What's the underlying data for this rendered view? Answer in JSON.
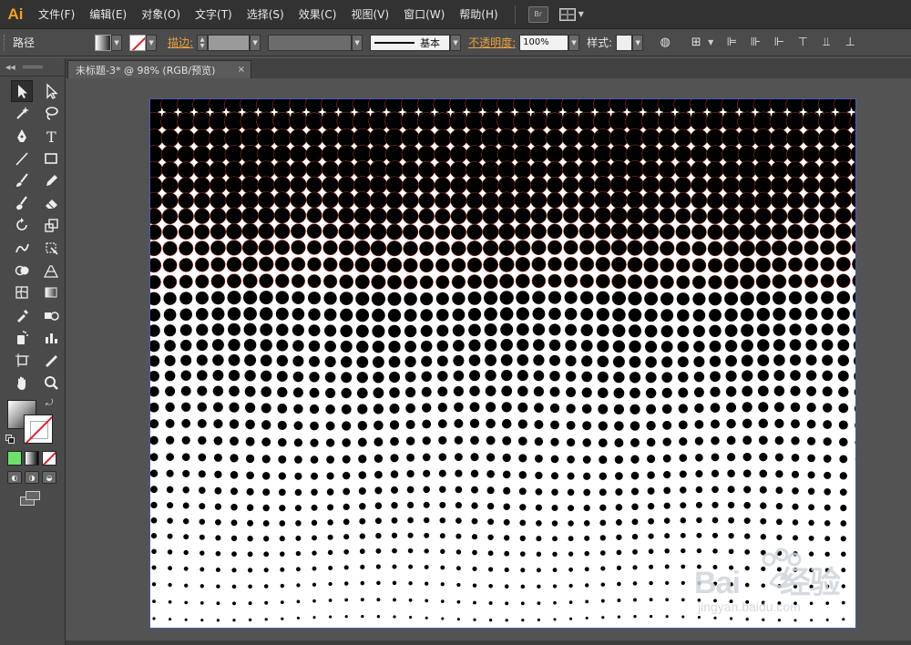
{
  "app": {
    "logo": "Ai"
  },
  "menu": {
    "items": [
      "文件(F)",
      "编辑(E)",
      "对象(O)",
      "文字(T)",
      "选择(S)",
      "效果(C)",
      "视图(V)",
      "窗口(W)",
      "帮助(H)"
    ],
    "bridge": "Br"
  },
  "control": {
    "selection_type": "路径",
    "stroke_label": "描边:",
    "stroke_style": "基本",
    "opacity_label": "不透明度:",
    "opacity_value": "100%",
    "style_label": "样式:"
  },
  "document": {
    "tab_title": "未标题-3* @ 98% (RGB/预览)",
    "close_glyph": "×"
  },
  "tools": [
    {
      "name": "selection-tool"
    },
    {
      "name": "direct-selection-tool"
    },
    {
      "name": "magic-wand-tool"
    },
    {
      "name": "lasso-tool"
    },
    {
      "name": "pen-tool"
    },
    {
      "name": "type-tool",
      "glyph": "T"
    },
    {
      "name": "line-segment-tool"
    },
    {
      "name": "rectangle-tool"
    },
    {
      "name": "paintbrush-tool"
    },
    {
      "name": "pencil-tool"
    },
    {
      "name": "blob-brush-tool"
    },
    {
      "name": "eraser-tool"
    },
    {
      "name": "rotate-tool"
    },
    {
      "name": "scale-tool"
    },
    {
      "name": "warp-tool"
    },
    {
      "name": "free-transform-tool"
    },
    {
      "name": "shape-builder-tool"
    },
    {
      "name": "perspective-grid-tool"
    },
    {
      "name": "mesh-tool"
    },
    {
      "name": "gradient-tool"
    },
    {
      "name": "eyedropper-tool"
    },
    {
      "name": "blend-tool"
    },
    {
      "name": "symbol-sprayer-tool"
    },
    {
      "name": "column-graph-tool"
    },
    {
      "name": "artboard-tool"
    },
    {
      "name": "slice-tool"
    },
    {
      "name": "hand-tool"
    },
    {
      "name": "zoom-tool"
    }
  ],
  "watermark": {
    "main": "Bai",
    "main2": "经验",
    "sub": "jingyan.baidu.com"
  },
  "colors": {
    "accent": "#f7a21b",
    "selection": "#4a5ab8",
    "stroke_none": "#e0202a"
  }
}
